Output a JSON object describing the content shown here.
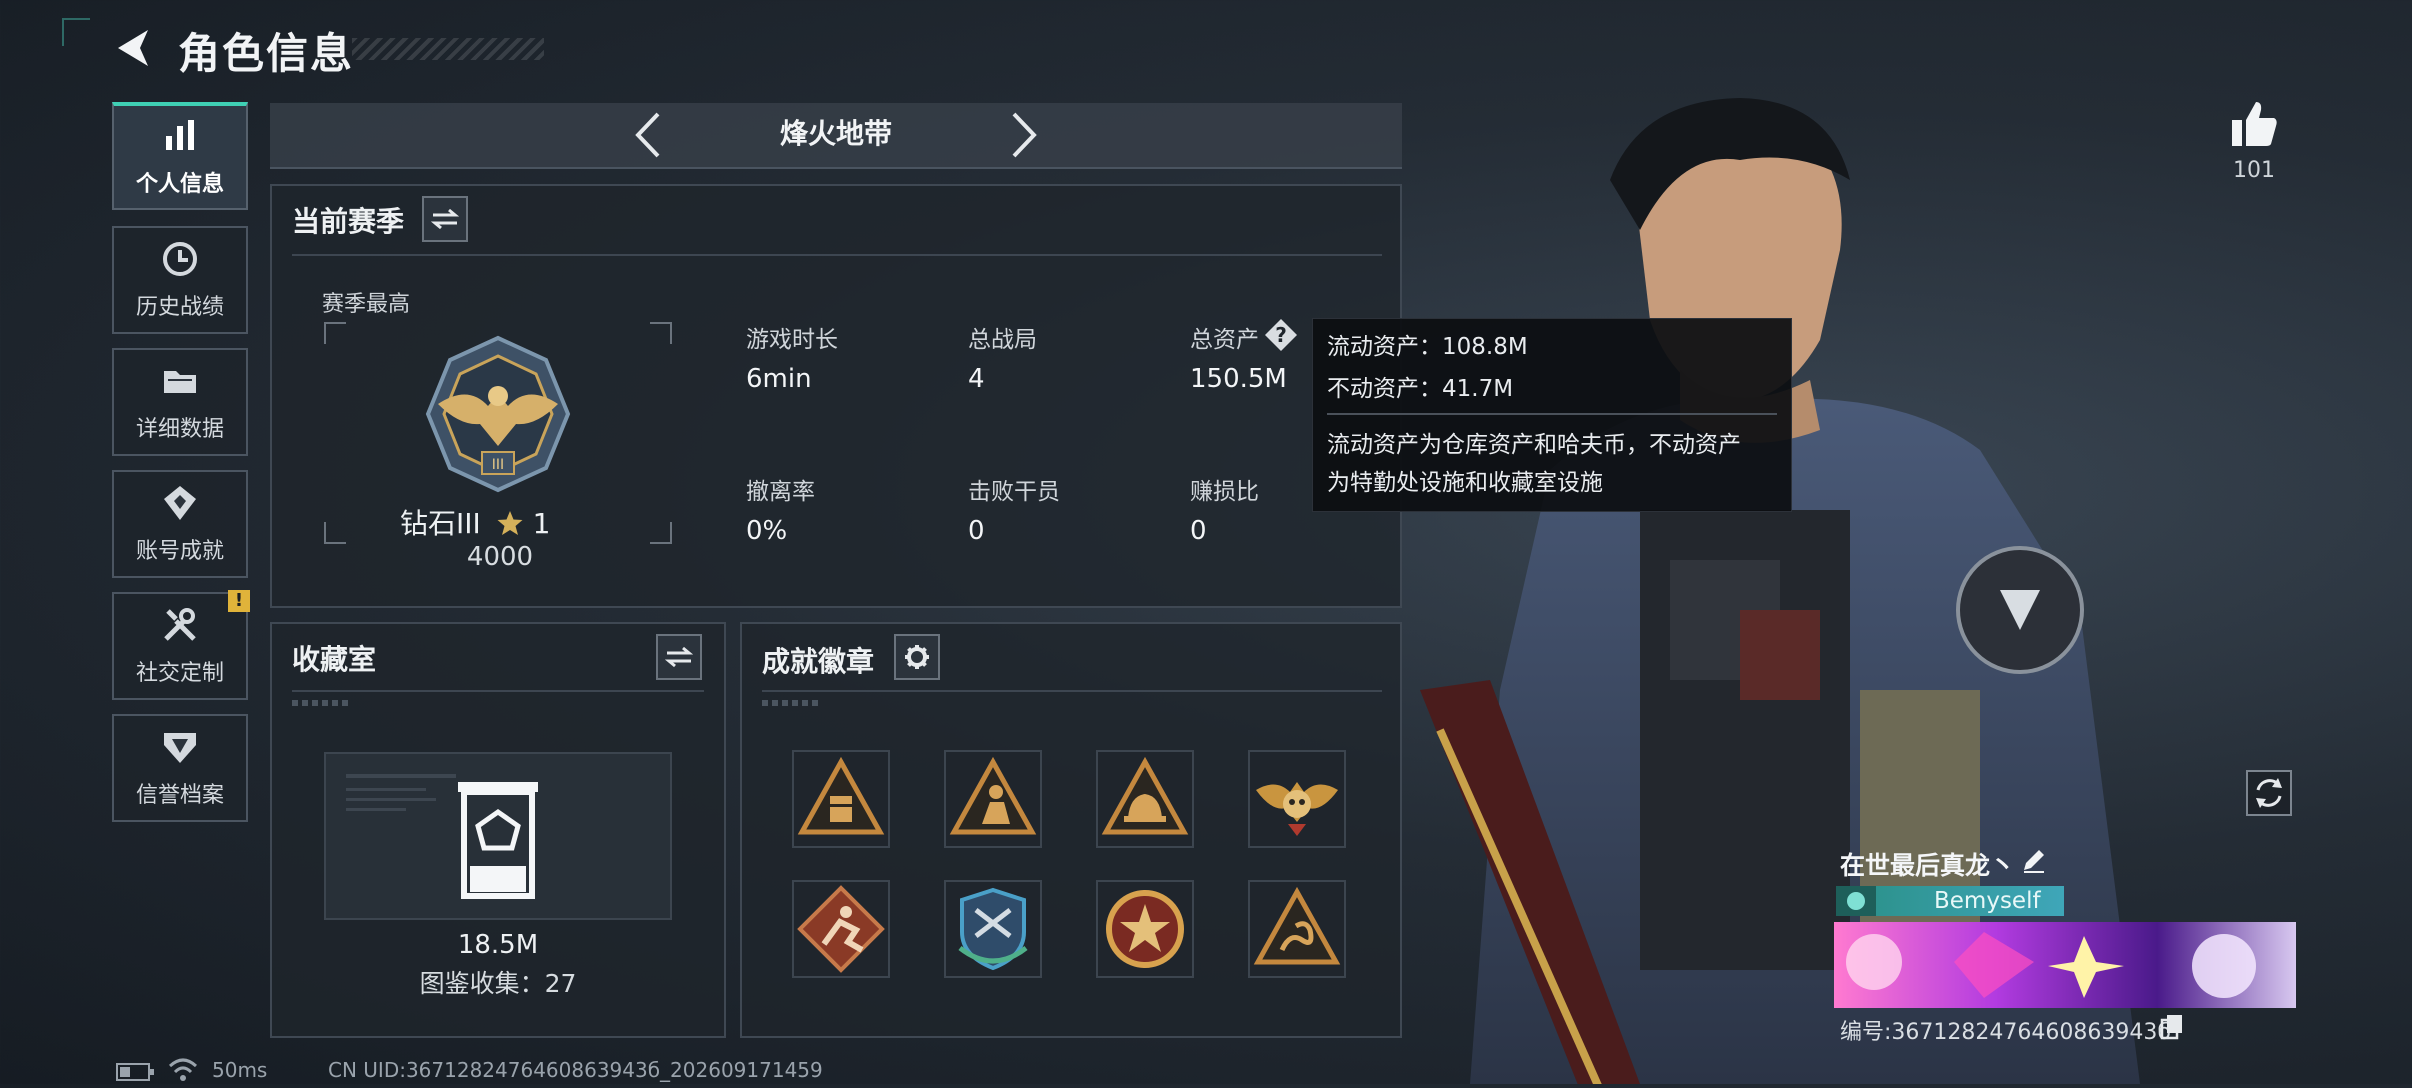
{
  "header": {
    "title": "角色信息"
  },
  "sidebar": {
    "items": [
      {
        "label": "个人信息",
        "icon": "bar-chart-icon",
        "active": true
      },
      {
        "label": "历史战绩",
        "icon": "clock-icon"
      },
      {
        "label": "详细数据",
        "icon": "folder-icon"
      },
      {
        "label": "账号成就",
        "icon": "achievement-icon"
      },
      {
        "label": "社交定制",
        "icon": "tools-icon",
        "badge": "!"
      },
      {
        "label": "信誉档案",
        "icon": "reputation-icon"
      }
    ]
  },
  "mode": {
    "title": "烽火地带"
  },
  "season": {
    "title": "当前赛季",
    "best_label": "赛季最高",
    "rank_name": "钻石III",
    "rank_stars": "1",
    "rank_score": "4000",
    "stats": [
      {
        "label": "游戏时长",
        "value": "6min"
      },
      {
        "label": "总战局",
        "value": "4"
      },
      {
        "label": "总资产",
        "value": "150.5M"
      },
      {
        "label": "撤离率",
        "value": "0%"
      },
      {
        "label": "击败干员",
        "value": "0"
      },
      {
        "label": "赚损比",
        "value": "0"
      }
    ]
  },
  "tooltip": {
    "liquid": "流动资产：108.8M",
    "fixed": "不动资产：41.7M",
    "desc_line1": "流动资产为仓库资产和哈夫币，不动资产",
    "desc_line2": "为特勤处设施和收藏室设施"
  },
  "collection": {
    "title": "收藏室",
    "value": "18.5M",
    "count": "图鉴收集：27"
  },
  "achievements": {
    "title": "成就徽章",
    "badges": [
      {
        "icon": "triangle-crate-badge",
        "color": "#c4883e"
      },
      {
        "icon": "triangle-soldier-badge",
        "color": "#c4883e"
      },
      {
        "icon": "triangle-helmet-badge",
        "color": "#c4883e"
      },
      {
        "icon": "eagle-skull-badge",
        "color": "#c9953f"
      },
      {
        "icon": "diamond-runner-badge",
        "color": "#b8573a"
      },
      {
        "icon": "shield-wings-badge",
        "color": "#3e7fb0"
      },
      {
        "icon": "star-medal-badge",
        "color": "#b03a2e"
      },
      {
        "icon": "triangle-snake-badge",
        "color": "#c4883e"
      }
    ]
  },
  "character": {
    "likes": "101",
    "name": "在世最后真龙丶",
    "tag": "Bemyself",
    "id": "编号:3671282476460863943б"
  },
  "status": {
    "ping": "50ms",
    "uid": "CN UID:3671282476460863943б_202609171459"
  },
  "colors": {
    "accent": "#3fd0b4",
    "gold": "#c4883e",
    "badge_warning": "#e0b33a"
  }
}
